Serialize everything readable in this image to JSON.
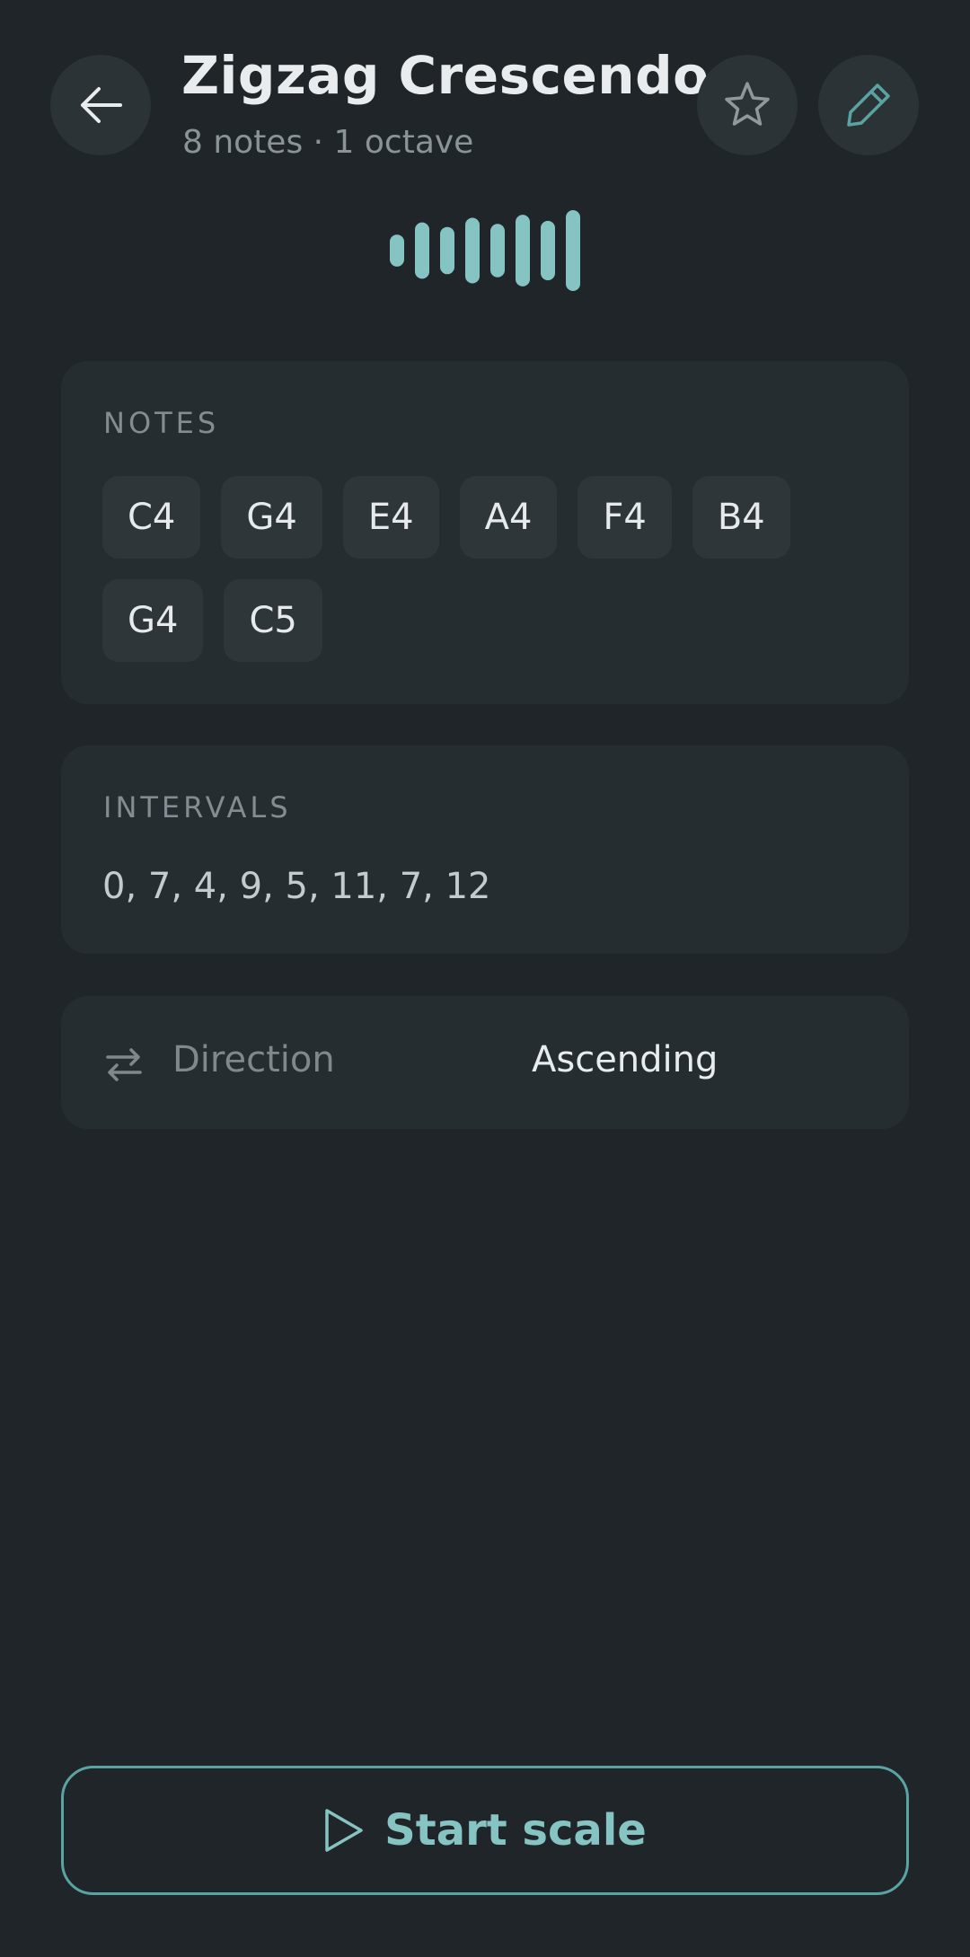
{
  "header": {
    "title": "Zigzag Crescendo",
    "subtitle": "8 notes · 1 octave",
    "back_icon": "arrow-left-icon",
    "favorite_icon": "star-icon",
    "edit_icon": "pencil-icon"
  },
  "waveform": {
    "icon": "waveform-icon",
    "bar_levels": [
      0.2,
      0.6,
      0.45,
      0.75,
      0.55,
      0.85,
      0.65,
      1.0
    ]
  },
  "notes": {
    "label": "NOTES",
    "items": [
      "C4",
      "G4",
      "E4",
      "A4",
      "F4",
      "B4",
      "G4",
      "C5"
    ]
  },
  "intervals": {
    "label": "INTERVALS",
    "value": "0, 7, 4, 9, 5, 11, 7, 12"
  },
  "direction": {
    "icon": "swap-arrows-icon",
    "label": "Direction",
    "value": "Ascending"
  },
  "start": {
    "icon": "play-icon",
    "label": "Start scale"
  },
  "colors": {
    "background": "#1f2528",
    "card": "#262d30",
    "accent": "#86c3c3",
    "accent_border": "#5aa3a3"
  }
}
